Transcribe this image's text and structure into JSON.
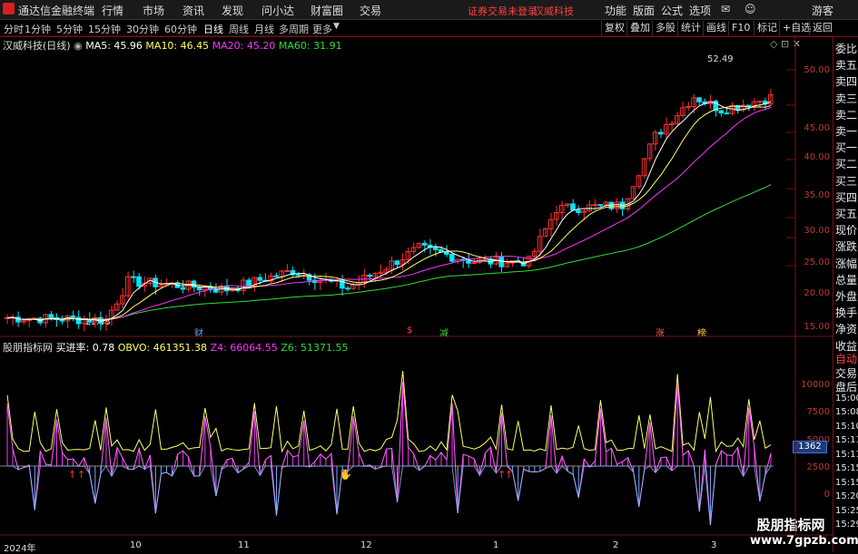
{
  "menubar": {
    "app_name": "通达信金融终端",
    "items": [
      "行情",
      "市场",
      "资讯",
      "发现",
      "问小达",
      "财富圈",
      "交易"
    ],
    "notice": "证券交易未登录",
    "stock_name": "汉威科技",
    "right_items": [
      "功能",
      "版面",
      "公式",
      "选项"
    ],
    "guest": "游客"
  },
  "toolbar": {
    "timeframes": [
      "分时",
      "1分钟",
      "5分钟",
      "15分钟",
      "30分钟",
      "60分钟",
      "日线",
      "周线",
      "月线",
      "多周期",
      "更多"
    ],
    "active": "日线",
    "buttons": [
      "复权",
      "叠加",
      "多股",
      "统计",
      "画线",
      "F10",
      "标记",
      "+自选",
      "返回"
    ]
  },
  "main_legend": {
    "title": "汉威科技(日线)",
    "ma5": "MA5: 45.96",
    "ma10": "MA10: 46.45",
    "ma20": "MA20: 45.20",
    "ma60": "MA60: 31.91"
  },
  "sub_legend": {
    "title": "股朋指标网",
    "buy_rate": "买进率: 0.78",
    "obvo": "OBVO: 461351.38",
    "z4": "Z4: 66064.55",
    "z6": "Z6: 51371.55"
  },
  "price_axis": [
    "50.00",
    "45.00",
    "40.00",
    "35.00",
    "30.00",
    "25.00",
    "20.00",
    "15.00"
  ],
  "sub_axis": [
    "10000",
    "7500",
    "5000",
    "2500",
    "0"
  ],
  "annotations": {
    "high": "52.49",
    "low": "11.88"
  },
  "event_marks": [
    "财",
    "$",
    "减",
    "涨",
    "榜"
  ],
  "current_value": "1362",
  "date_axis": [
    "2024年",
    "10",
    "11",
    "12",
    "1",
    "2",
    "3"
  ],
  "right_panel": [
    "委比",
    "卖五",
    "卖四",
    "卖三",
    "卖二",
    "卖一",
    "买一",
    "买二",
    "买三",
    "买四",
    "买五",
    "现价",
    "涨跌",
    "涨幅",
    "总量",
    "外盘",
    "换手",
    "净资",
    "收益"
  ],
  "right_panel_lower": [
    "自动",
    "交易",
    "盘后",
    "15:00",
    "15:08",
    "15:10",
    "15:11",
    "15:11",
    "15:15",
    "15:15",
    "15:20",
    "15:25",
    "15:29"
  ],
  "watermark": {
    "line1": "股朋指标网",
    "line2": "www.7gpzb.com"
  },
  "colors": {
    "up": "#ff3030",
    "down": "#00e5ff",
    "ma5": "#ffffff",
    "ma10": "#ffff66",
    "ma20": "#ff33ff",
    "ma60": "#33dd33",
    "grid": "#7a1010"
  }
}
